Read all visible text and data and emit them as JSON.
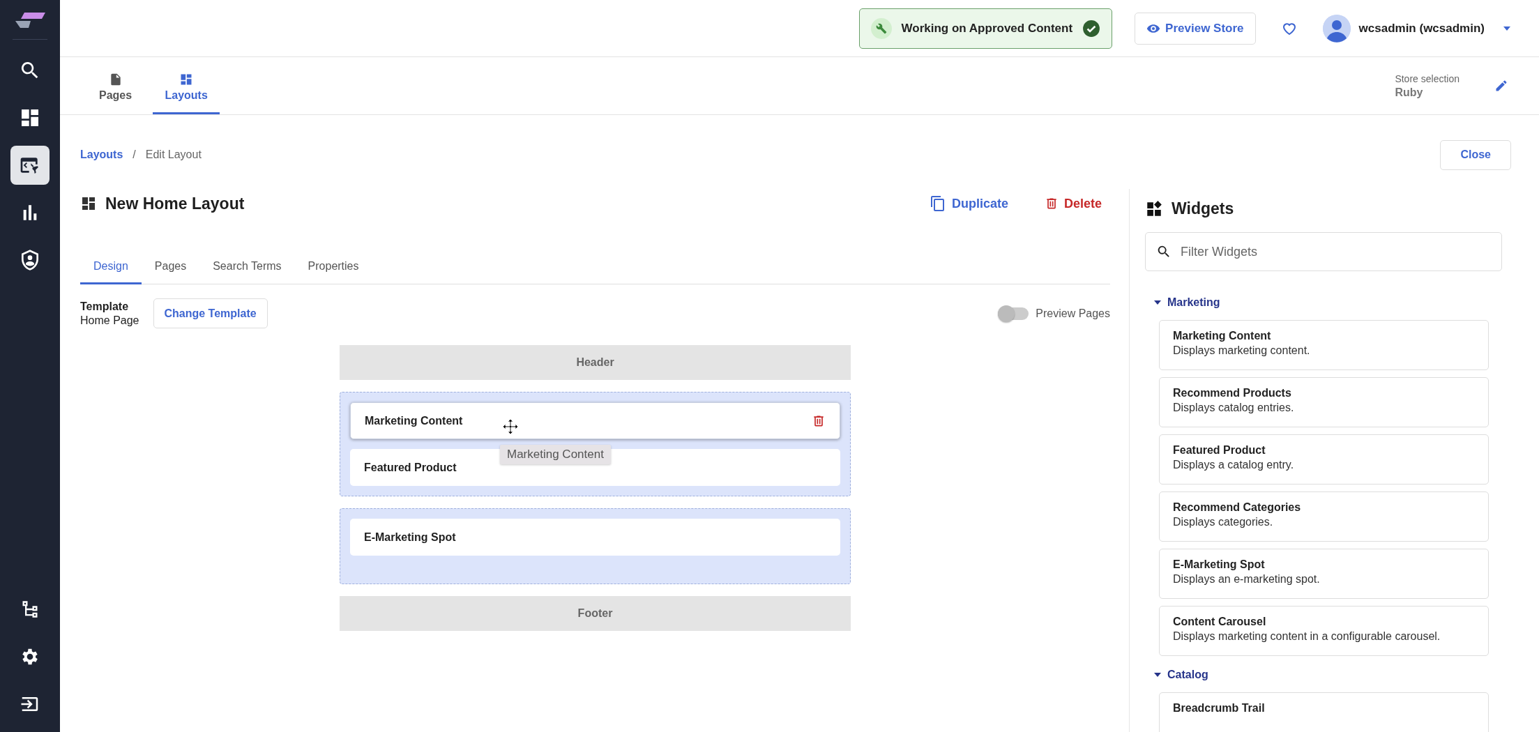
{
  "sidebar": {
    "items": [
      {
        "selected": false
      },
      {
        "selected": false
      },
      {
        "selected": true
      },
      {
        "selected": false
      },
      {
        "selected": false
      }
    ]
  },
  "top_bar": {
    "status": "Working on Approved Content",
    "preview_button": "Preview Store",
    "user": "wcsadmin (wcsadmin)"
  },
  "nav_tabs": [
    {
      "label": "Pages",
      "selected": false
    },
    {
      "label": "Layouts",
      "selected": true
    }
  ],
  "store": {
    "label": "Store selection",
    "value": "Ruby"
  },
  "breadcrumb": {
    "link": "Layouts",
    "separator": "/",
    "current": "Edit Layout"
  },
  "close_button": "Close",
  "layout": {
    "title": "New Home Layout",
    "duplicate": "Duplicate",
    "delete": "Delete"
  },
  "tabs": [
    {
      "label": "Design",
      "selected": true
    },
    {
      "label": "Pages",
      "selected": false
    },
    {
      "label": "Search Terms",
      "selected": false
    },
    {
      "label": "Properties",
      "selected": false
    }
  ],
  "template": {
    "label": "Template",
    "value": "Home Page",
    "button": "Change Template"
  },
  "preview_toggle": {
    "label": "Preview Pages",
    "on": false
  },
  "canvas": {
    "header": "Header",
    "footer": "Footer",
    "drag_label": "Marketing Content",
    "slots": [
      {
        "widgets": [
          {
            "name": "Marketing Content",
            "selected": true
          },
          {
            "name": "Featured Product",
            "selected": false
          }
        ]
      },
      {
        "widgets": [
          {
            "name": "E-Marketing Spot",
            "selected": false
          }
        ]
      }
    ]
  },
  "widgets_panel": {
    "title": "Widgets",
    "filter_placeholder": "Filter Widgets",
    "categories": [
      {
        "name": "Marketing",
        "expanded": true,
        "widgets": [
          {
            "name": "Marketing Content",
            "description": "Displays marketing content."
          },
          {
            "name": "Recommend Products",
            "description": "Displays catalog entries."
          },
          {
            "name": "Featured Product",
            "description": "Displays a catalog entry."
          },
          {
            "name": "Recommend Categories",
            "description": "Displays categories."
          },
          {
            "name": "E-Marketing Spot",
            "description": "Displays an e-marketing spot."
          },
          {
            "name": "Content Carousel",
            "description": "Displays marketing content in a configurable carousel."
          }
        ]
      },
      {
        "name": "Catalog",
        "expanded": true,
        "widgets": [
          {
            "name": "Breadcrumb Trail"
          }
        ]
      }
    ]
  }
}
